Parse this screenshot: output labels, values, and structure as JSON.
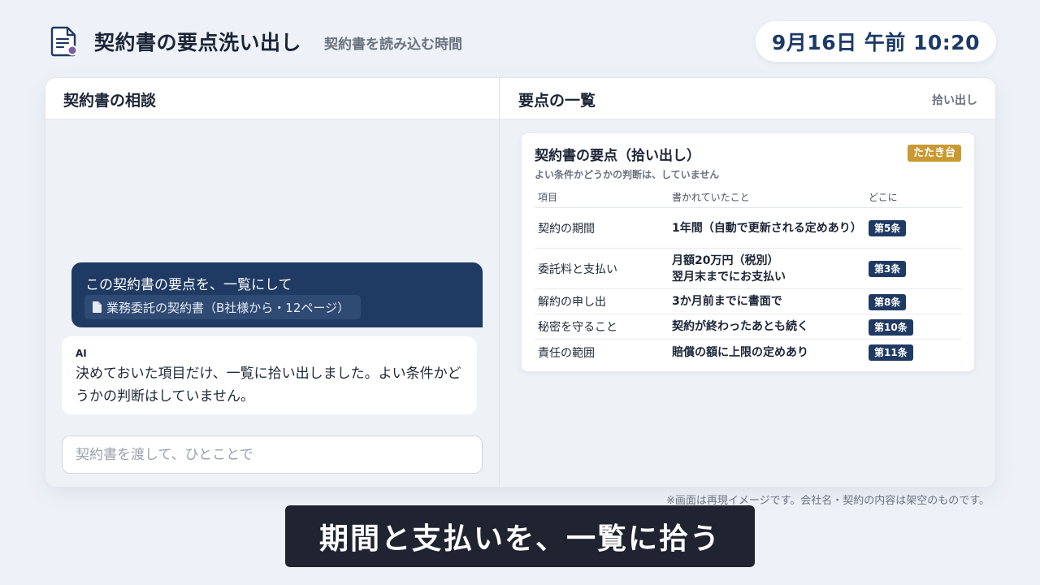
{
  "header": {
    "app_title": "契約書の要点洗い出し",
    "app_subtitle": "契約書を読み込む時間",
    "clock": "9月16日 午前 10:20",
    "icon": "document-icon"
  },
  "chat_panel": {
    "title": "契約書の相談",
    "user_message": "この契約書の要点を、一覧にして",
    "attachment": "業務委託の契約書（B社様から・12ページ）",
    "ai_label": "AI",
    "ai_message": "決めておいた項目だけ、一覧に拾い出しました。よい条件かどうかの判断はしていません。",
    "input_placeholder": "契約書を渡して、ひとことで"
  },
  "summary_panel": {
    "title": "要点の一覧",
    "action_label": "拾い出し",
    "card": {
      "title": "契約書の要点（拾い出し）",
      "badge": "たたき台",
      "note": "よい条件かどうかの判断は、していません",
      "columns": [
        "項目",
        "書かれていたこと",
        "どこに"
      ],
      "rows": [
        {
          "item": "契約の期間",
          "content": "1年間（自動で更新される定めあり）",
          "article": "第5条"
        },
        {
          "item": "委託料と支払い",
          "content": "月額20万円（税別）\n翌月末までにお支払い",
          "article": "第3条"
        },
        {
          "item": "解約の申し出",
          "content": "3か月前までに書面で",
          "article": "第8条"
        },
        {
          "item": "秘密を守ること",
          "content": "契約が終わったあとも続く",
          "article": "第10条"
        },
        {
          "item": "責任の範囲",
          "content": "賠償の額に上限の定めあり",
          "article": "第11条"
        }
      ]
    }
  },
  "footer": {
    "disclaimer": "※画面は再現イメージです。会社名・契約の内容は架空のものです。",
    "caption": "期間と支払いを、一覧に拾う"
  },
  "colors": {
    "accent_navy": "#1f3a63",
    "badge_gold": "#c99a33",
    "background": "#eef2f8"
  }
}
